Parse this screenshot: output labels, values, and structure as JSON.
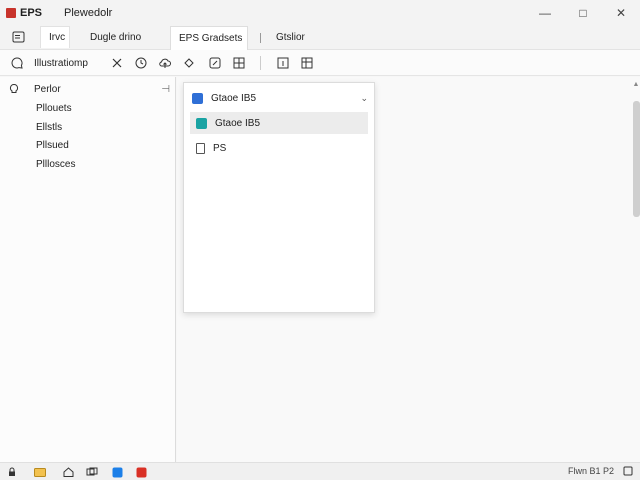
{
  "window": {
    "app_name": "EPS",
    "document_name": "Plewedolr",
    "minimize": "—",
    "maximize": "□",
    "close": "✕",
    "accent": "#c8332b"
  },
  "tabs": {
    "view": "Irvc",
    "plain": "Dugle drino",
    "active": "EPS Gradsets",
    "extra": "Gtslior"
  },
  "toolbar": {
    "label": "Illustratiomp"
  },
  "sidebar": {
    "header": "Perlor",
    "collapse": "⊣",
    "items": [
      "Pllouets",
      "Ellstls",
      "Pllsued",
      "Plllosces"
    ]
  },
  "dropdown": {
    "selected": "Gtaoe IB5",
    "options": [
      {
        "label": "Gtaoe IB5",
        "icon": "teal-square-icon"
      },
      {
        "label": "PS",
        "icon": "document-icon"
      }
    ],
    "chevron": "⌄"
  },
  "statusbar": {
    "status_text": "Flwn B1 P2"
  }
}
